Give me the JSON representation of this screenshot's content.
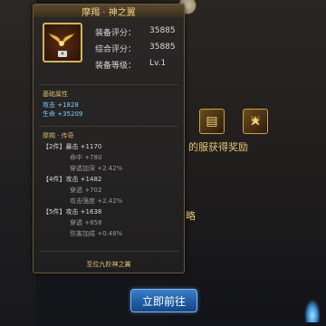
{
  "tooltip": {
    "title": "摩羯 · 神之翼",
    "stats": [
      {
        "label": "装备评分：",
        "value": "35885"
      },
      {
        "label": "综合评分：",
        "value": "35885"
      },
      {
        "label": "装备等级：",
        "value": "Lv.1"
      }
    ],
    "base_section": {
      "heading": "基础属性",
      "lines": [
        "攻击 +1828",
        "生命 +35209"
      ]
    },
    "set_section": {
      "heading": "摩羯 · 传奇",
      "lines": [
        "【2件】暴击 +1170",
        "命中 +780",
        "穿透加深 +2.42%",
        "【4件】攻击 +1482",
        "穿透 +702",
        "攻击强度 +2.42%",
        "【5件】攻击 +1638",
        "穿透 +858",
        "伤害加成 +0.48%"
      ]
    },
    "footer": "至位九阶神之翼"
  },
  "background": {
    "reward_text": "的服获得奖励",
    "route_text": "略"
  },
  "actions": {
    "go_label": "立即前往"
  },
  "colors": {
    "gold": "#d7b96a",
    "cyan": "#7fd0ff",
    "button": "#2a6db6"
  }
}
